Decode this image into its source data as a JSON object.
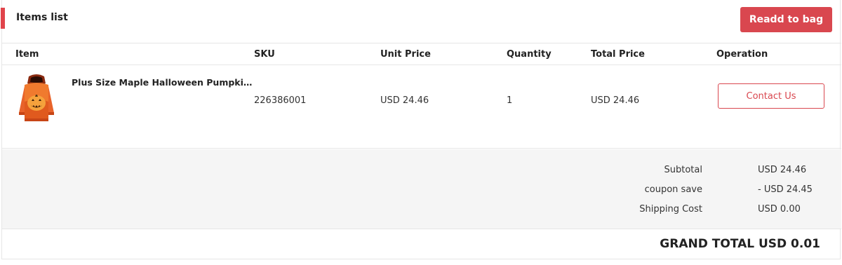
{
  "header": {
    "title": "Items list",
    "readd_label": "Readd to bag"
  },
  "columns": {
    "item": "Item",
    "sku": "SKU",
    "unit_price": "Unit Price",
    "quantity": "Quantity",
    "total_price": "Total Price",
    "operation": "Operation"
  },
  "items": [
    {
      "name": "Plus Size Maple Halloween Pumpkin H...",
      "sku": "226386001",
      "unit_price": "USD 24.46",
      "quantity": "1",
      "total_price": "USD 24.46",
      "action_label": "Contact Us",
      "image_icon": "hoodie-product-icon"
    }
  ],
  "summary": {
    "subtotal_label": "Subtotal",
    "subtotal_value": "USD 24.46",
    "coupon_label": "coupon save",
    "coupon_value": "- USD 24.45",
    "shipping_label": "Shipping Cost",
    "shipping_value": "USD 0.00"
  },
  "grand_total": "GRAND TOTAL USD 0.01",
  "colors": {
    "accent": "#d9474f",
    "border": "#e6e6e6",
    "summary_bg": "#f5f5f5"
  }
}
